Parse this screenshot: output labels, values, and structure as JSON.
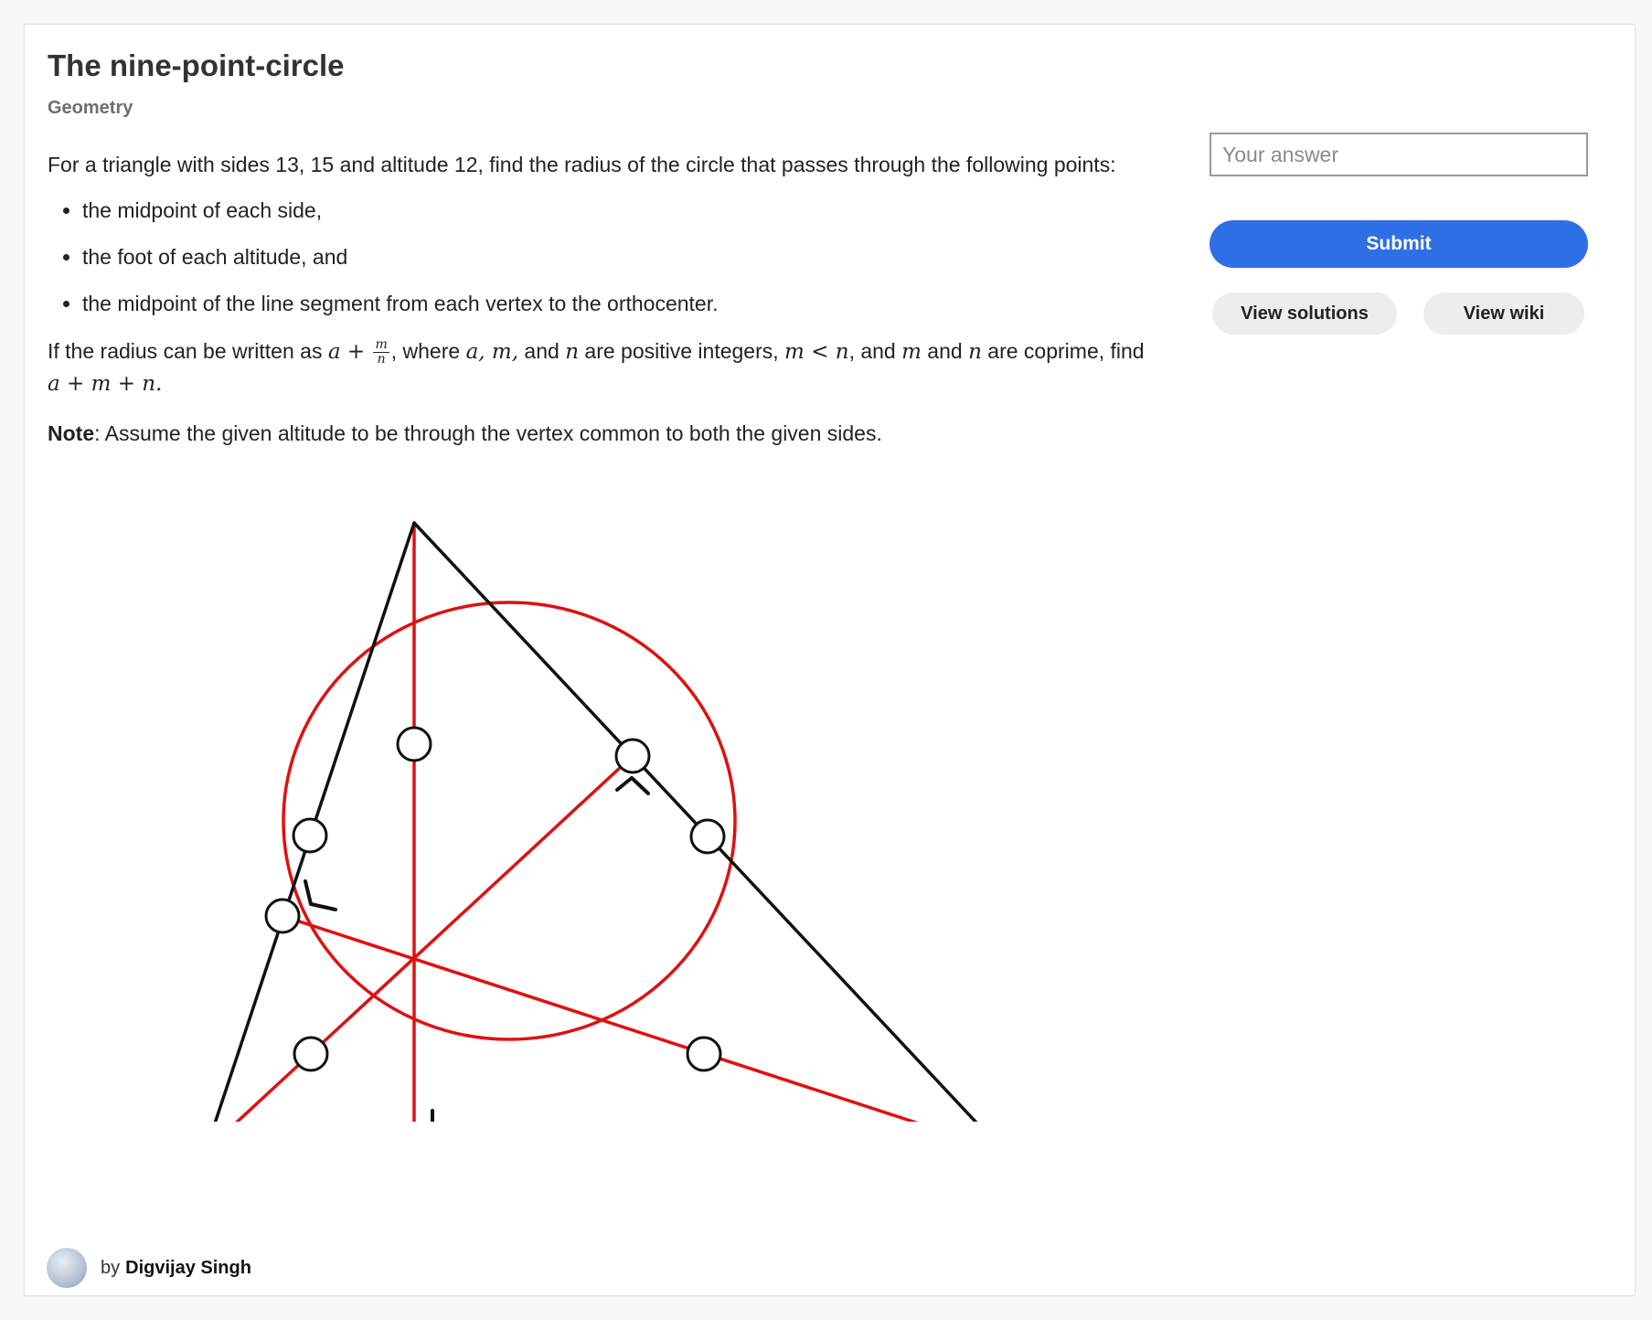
{
  "problem": {
    "title": "The nine-point-circle",
    "topic": "Geometry",
    "intro": "For a triangle with sides 13, 15 and altitude 12, find the radius of the circle that passes through the following points:",
    "bullets": [
      "the midpoint of each side,",
      "the foot of each altitude, and",
      "the midpoint of the line segment from each vertex to the orthocenter."
    ],
    "radius_text": {
      "prefix": "If the radius can be written as ",
      "expr_a": "a",
      "expr_plus": "+",
      "frac_num": "m",
      "frac_den": "n",
      "part2": ", where ",
      "vars": "a, m,",
      "part3": " and ",
      "var_n": "n",
      "part4": " are positive integers, ",
      "ineq": "m < n",
      "part5": ", and ",
      "var_m2": "m",
      "part6": " and ",
      "var_n2": "n",
      "part7": " are coprime, find",
      "final_expr": "a + m + n."
    },
    "note_label": "Note",
    "note_text": ": Assume the given altitude to be through the vertex common to both the given sides."
  },
  "answer": {
    "placeholder": "Your answer",
    "value": "",
    "submit_label": "Submit",
    "view_solutions_label": "View solutions",
    "view_wiki_label": "View wiki"
  },
  "author": {
    "by_label": "by",
    "name": "Digvijay Singh"
  },
  "colors": {
    "accent": "#2f6fe6",
    "circle": "#e01010",
    "triangle": "#111111"
  }
}
